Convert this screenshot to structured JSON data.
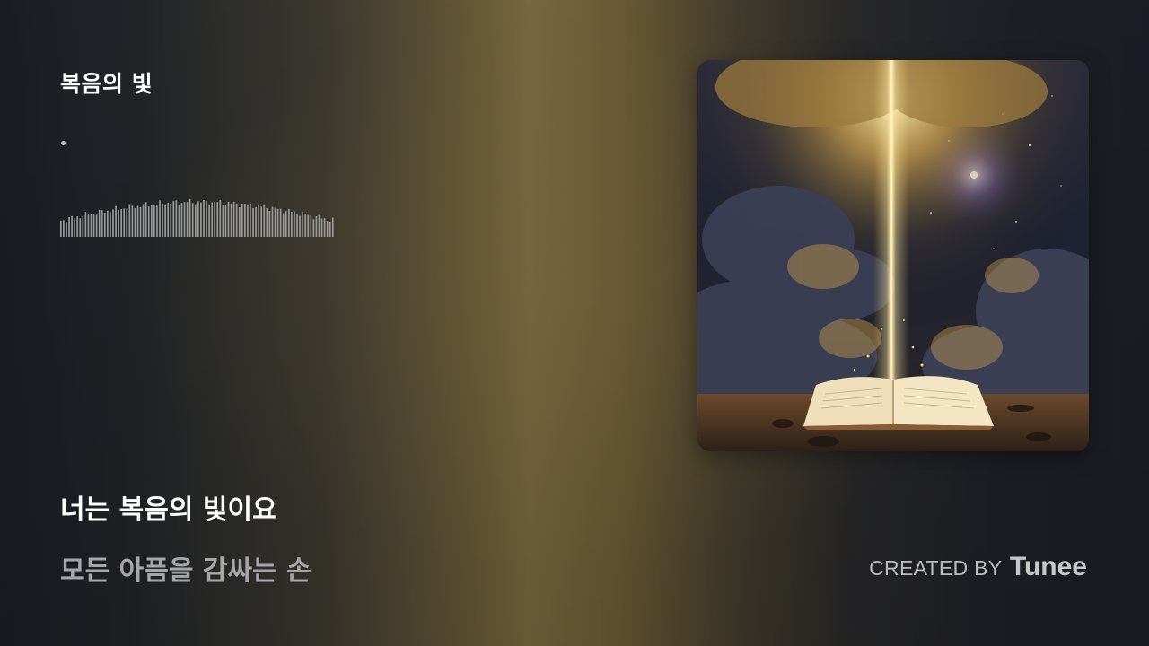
{
  "track": {
    "title": "복음의 빛"
  },
  "lyrics": {
    "current": "너는 복음의 빛이요",
    "next": "모든 아픔을 감싸는 손"
  },
  "credit": {
    "prefix": "CREATED BY",
    "brand": "Tunee"
  },
  "cover": {
    "icon": "album-art-open-book-light-beam"
  },
  "colors": {
    "accent_gold": "#f4d27a",
    "title": "#ffffff",
    "lyric_next": "#a7a7a9",
    "wave": "#9a9a9a"
  }
}
